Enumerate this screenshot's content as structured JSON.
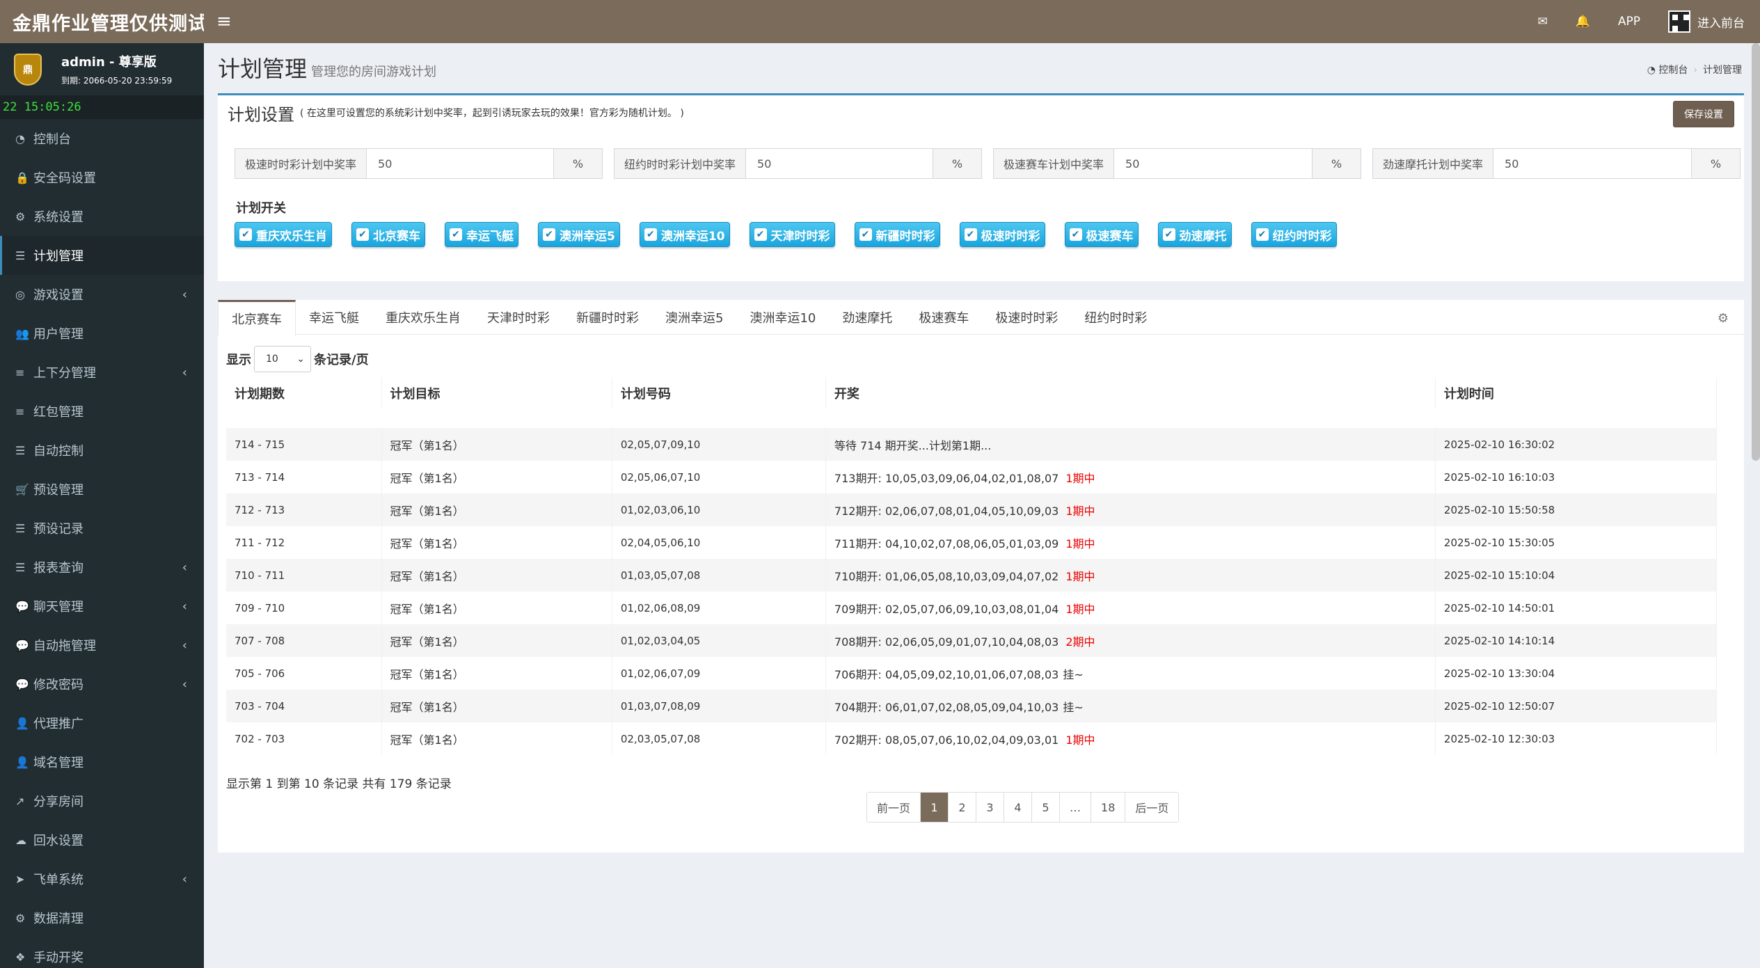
{
  "app": {
    "title": "金鼎作业管理仅供测试"
  },
  "topbar": {
    "app_label": "APP",
    "frontend_label": "进入前台"
  },
  "user": {
    "name": "admin - 尊享版",
    "expiry": "到期: 2066-05-20 23:59:59",
    "avatar_text": "鼎"
  },
  "clock": "22 15:05:26",
  "sidebar": {
    "items": [
      {
        "label": "控制台",
        "icon": "dashboard-icon",
        "glyph": "◔",
        "arrow": false,
        "active": false
      },
      {
        "label": "安全码设置",
        "icon": "lock-icon",
        "glyph": "🔒",
        "arrow": false,
        "active": false
      },
      {
        "label": "系统设置",
        "icon": "cogs-icon",
        "glyph": "⚙",
        "arrow": false,
        "active": false
      },
      {
        "label": "计划管理",
        "icon": "list-icon",
        "glyph": "☰",
        "arrow": false,
        "active": true
      },
      {
        "label": "游戏设置",
        "icon": "gamepad-icon",
        "glyph": "◎",
        "arrow": true,
        "active": false
      },
      {
        "label": "用户管理",
        "icon": "users-icon",
        "glyph": "👥",
        "arrow": false,
        "active": false
      },
      {
        "label": "上下分管理",
        "icon": "database-icon",
        "glyph": "≡",
        "arrow": true,
        "active": false
      },
      {
        "label": "红包管理",
        "icon": "database-icon",
        "glyph": "≡",
        "arrow": false,
        "active": false
      },
      {
        "label": "自动控制",
        "icon": "list-icon",
        "glyph": "☰",
        "arrow": false,
        "active": false
      },
      {
        "label": "预设管理",
        "icon": "cart-icon",
        "glyph": "🛒",
        "arrow": false,
        "active": false
      },
      {
        "label": "预设记录",
        "icon": "list-icon",
        "glyph": "☰",
        "arrow": false,
        "active": false
      },
      {
        "label": "报表查询",
        "icon": "list-icon",
        "glyph": "☰",
        "arrow": true,
        "active": false
      },
      {
        "label": "聊天管理",
        "icon": "comments-icon",
        "glyph": "💬",
        "arrow": true,
        "active": false
      },
      {
        "label": "自动拖管理",
        "icon": "comment-icon",
        "glyph": "💬",
        "arrow": true,
        "active": false
      },
      {
        "label": "修改密码",
        "icon": "comments-icon",
        "glyph": "💬",
        "arrow": true,
        "active": false
      },
      {
        "label": "代理推广",
        "icon": "user-plus-icon",
        "glyph": "👤",
        "arrow": false,
        "active": false
      },
      {
        "label": "域名管理",
        "icon": "user-plus-icon",
        "glyph": "👤",
        "arrow": false,
        "active": false
      },
      {
        "label": "分享房间",
        "icon": "share-icon",
        "glyph": "↗",
        "arrow": false,
        "active": false
      },
      {
        "label": "回水设置",
        "icon": "cloud-icon",
        "glyph": "☁",
        "arrow": false,
        "active": false
      },
      {
        "label": "飞单系统",
        "icon": "send-icon",
        "glyph": "➤",
        "arrow": true,
        "active": false
      },
      {
        "label": "数据清理",
        "icon": "cog-icon",
        "glyph": "⚙",
        "arrow": false,
        "active": false
      },
      {
        "label": "手动开奖",
        "icon": "cubes-icon",
        "glyph": "❖",
        "arrow": false,
        "active": false
      }
    ],
    "arrow_glyph": "‹"
  },
  "page": {
    "title": "计划管理",
    "subtitle": "管理您的房间游戏计划"
  },
  "breadcrumb": {
    "home": "控制台",
    "current": "计划管理"
  },
  "settings": {
    "title": "计划设置",
    "desc": "( 在这里可设置您的系统彩计划中奖率，起到引诱玩家去玩的效果！官方彩为随机计划。 )",
    "save_label": "保存设置",
    "inputs": [
      {
        "label": "极速时时彩计划中奖率",
        "value": "50",
        "unit": "%"
      },
      {
        "label": "纽约时时彩计划中奖率",
        "value": "50",
        "unit": "%"
      },
      {
        "label": "极速赛车计划中奖率",
        "value": "50",
        "unit": "%"
      },
      {
        "label": "劲速摩托计划中奖率",
        "value": "50",
        "unit": "%"
      }
    ],
    "switch_title": "计划开关",
    "switches": [
      "重庆欢乐生肖",
      "北京赛车",
      "幸运飞艇",
      "澳洲幸运5",
      "澳洲幸运10",
      "天津时时彩",
      "新疆时时彩",
      "极速时时彩",
      "极速赛车",
      "劲速摩托",
      "纽约时时彩"
    ]
  },
  "tabs": [
    "北京赛车",
    "幸运飞艇",
    "重庆欢乐生肖",
    "天津时时彩",
    "新疆时时彩",
    "澳洲幸运5",
    "澳洲幸运10",
    "劲速摩托",
    "极速赛车",
    "极速时时彩",
    "纽约时时彩"
  ],
  "length": {
    "prefix": "显示",
    "value": "10",
    "suffix": "条记录/页"
  },
  "table": {
    "headers": [
      "计划期数",
      "计划目标",
      "计划号码",
      "开奖",
      "计划时间"
    ],
    "rows": [
      {
        "period": "714 - 715",
        "target": "冠军（第1名）",
        "numbers": "02,05,07,09,10",
        "result": "等待 714 期开奖...计划第1期...",
        "status": "",
        "time": "2025-02-10 16:30:02"
      },
      {
        "period": "713 - 714",
        "target": "冠军（第1名）",
        "numbers": "02,05,06,07,10",
        "result": "713期开: 10,05,03,09,06,04,02,01,08,07",
        "status": "1期中",
        "time": "2025-02-10 16:10:03"
      },
      {
        "period": "712 - 713",
        "target": "冠军（第1名）",
        "numbers": "01,02,03,06,10",
        "result": "712期开: 02,06,07,08,01,04,05,10,09,03",
        "status": "1期中",
        "time": "2025-02-10 15:50:58"
      },
      {
        "period": "711 - 712",
        "target": "冠军（第1名）",
        "numbers": "02,04,05,06,10",
        "result": "711期开: 04,10,02,07,08,06,05,01,03,09",
        "status": "1期中",
        "time": "2025-02-10 15:30:05"
      },
      {
        "period": "710 - 711",
        "target": "冠军（第1名）",
        "numbers": "01,03,05,07,08",
        "result": "710期开: 01,06,05,08,10,03,09,04,07,02",
        "status": "1期中",
        "time": "2025-02-10 15:10:04"
      },
      {
        "period": "709 - 710",
        "target": "冠军（第1名）",
        "numbers": "01,02,06,08,09",
        "result": "709期开: 02,05,07,06,09,10,03,08,01,04",
        "status": "1期中",
        "time": "2025-02-10 14:50:01"
      },
      {
        "period": "707 - 708",
        "target": "冠军（第1名）",
        "numbers": "01,02,03,04,05",
        "result": "708期开: 02,06,05,09,01,07,10,04,08,03",
        "status": "2期中",
        "time": "2025-02-10 14:10:14"
      },
      {
        "period": "705 - 706",
        "target": "冠军（第1名）",
        "numbers": "01,02,06,07,09",
        "result": "706期开: 04,05,09,02,10,01,06,07,08,03",
        "status": "挂~",
        "time": "2025-02-10 13:30:04"
      },
      {
        "period": "703 - 704",
        "target": "冠军（第1名）",
        "numbers": "01,03,07,08,09",
        "result": "704期开: 06,01,07,02,08,05,09,04,10,03",
        "status": "挂~",
        "time": "2025-02-10 12:50:07"
      },
      {
        "period": "702 - 703",
        "target": "冠军（第1名）",
        "numbers": "02,03,05,07,08",
        "result": "702期开: 08,05,07,06,10,02,04,09,03,01",
        "status": "1期中",
        "time": "2025-02-10 12:30:03"
      }
    ]
  },
  "table_info": "显示第 1 到第 10 条记录 共有 179 条记录",
  "pagination": [
    "前一页",
    "1",
    "2",
    "3",
    "4",
    "5",
    "…",
    "18",
    "后一页"
  ],
  "pagination_current": "1",
  "colors": {
    "topbar": "#7a6b5a",
    "sidebar": "#222d32",
    "accent": "#3c8dbc",
    "switch": "#19a5de",
    "hit": "#e00000"
  }
}
